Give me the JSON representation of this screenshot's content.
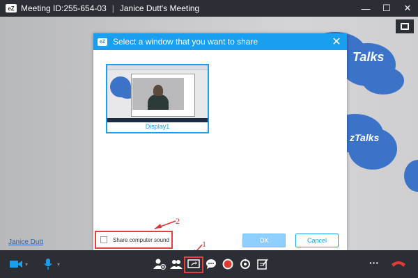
{
  "titlebar": {
    "logo_text": "eZ",
    "meeting_id": "Meeting ID:255-654-03",
    "separator": "|",
    "meeting_name": "Janice Dutt's Meeting",
    "minimize": "—",
    "maximize": "☐",
    "close": "✕"
  },
  "video": {
    "participant_name": "Janice Dutt",
    "cloud_text_1": "Talks",
    "cloud_text_2": "zTalks"
  },
  "dialog": {
    "icon_text": "eZ",
    "title": "Select a window that you want to share",
    "close": "✕",
    "display_label": "Display1",
    "share_sound_label": "Share computer sound",
    "ok_label": "OK",
    "cancel_label": "Cancel"
  },
  "annotations": {
    "label_1": "1",
    "label_2": "2"
  },
  "toolbar": {
    "icons": [
      "camera-icon",
      "microphone-icon",
      "add-participant-icon",
      "participants-icon",
      "screen-share-icon",
      "chat-icon",
      "record-icon",
      "sync-icon",
      "note-icon",
      "more-icon",
      "end-call-icon"
    ],
    "more_label": "···"
  },
  "colors": {
    "accent": "#1a9ff0",
    "annotation": "#e03030",
    "bar": "#2b2e35",
    "end_call": "#e53935"
  }
}
